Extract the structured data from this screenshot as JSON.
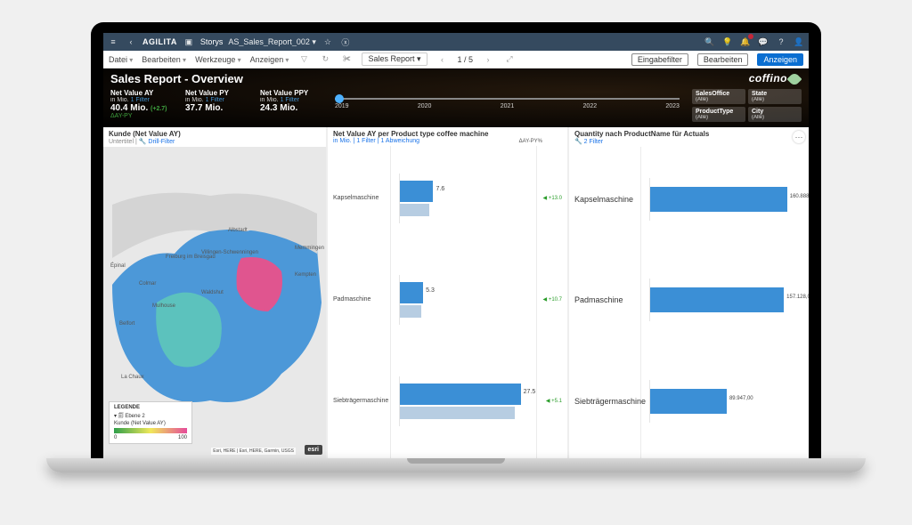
{
  "topbar": {
    "logo": "AGILITA",
    "storys": "Storys",
    "doc_name": "AS_Sales_Report_002 ▾"
  },
  "menubar": {
    "items": [
      "Datei",
      "Bearbeiten",
      "Werkzeuge",
      "Anzeigen"
    ],
    "selector": "Sales Report  ▾",
    "pager": "1 / 5",
    "filter_btn": "Eingabefilter",
    "edit_btn": "Bearbeiten",
    "show_btn": "Anzeigen"
  },
  "header": {
    "title": "Sales Report  - Overview",
    "brand": "coffino",
    "kpis": [
      {
        "label": "Net Value AY",
        "unit": "in Mio.",
        "filter": "1 Filter",
        "value": "40.4 Mio.",
        "delta": "(+2.7)",
        "sub": "ΔAY-PY"
      },
      {
        "label": "Net Value PY",
        "unit": "in Mio.",
        "filter": "1 Filter",
        "value": "37.7 Mio."
      },
      {
        "label": "Net Value PPY",
        "unit": "in Mio.",
        "filter": "1 Filter",
        "value": "24.3 Mio."
      }
    ],
    "timeline_years": [
      "2019",
      "2020",
      "2021",
      "2022",
      "2023"
    ],
    "chips": [
      {
        "label": "SalesOffice",
        "value": "(Alle)"
      },
      {
        "label": "State",
        "value": "(Alle)"
      },
      {
        "label": "ProductType",
        "value": "(Alle)"
      },
      {
        "label": "City",
        "value": "(Alle)"
      }
    ]
  },
  "panel_map": {
    "title": "Kunde (Net Value AY)",
    "subtitle_prefix": "Untertitel |",
    "drill_link": "Drill-Filter",
    "cities": [
      "Épinal",
      "Colmar",
      "Freiburg im Breisgau",
      "Mulhouse",
      "Belfort",
      "La Chaux",
      "Albstadt",
      "Villingen-Schwenningen",
      "Waldshut",
      "Memmingen",
      "Kempten"
    ],
    "legend_title": "LEGENDE",
    "legend_layer": "Ebene 2",
    "legend_metric": "Kunde (Net Value AY)",
    "legend_min": "0",
    "legend_max": "100",
    "credits": "Esri, HERE | Esri, HERE, Garmin, USGS",
    "esri": "esri"
  },
  "panel_mid": {
    "title": "Net Value AY per Product type coffee machine",
    "subtitle": "in Mio. | 1 Filter | 1 Abweichung",
    "delta_head": "ΔAY-PY%"
  },
  "panel_right": {
    "title": "Quantity nach ProductName für Actuals",
    "subtitle": "2 Filter"
  },
  "chart_data": [
    {
      "type": "bar",
      "title": "Net Value AY per Product type coffee machine",
      "ylabel": "in Mio.",
      "categories": [
        "Kapselmaschine",
        "Padmaschine",
        "Siebträgermaschine"
      ],
      "series": [
        {
          "name": "AY",
          "values": [
            7.6,
            5.3,
            27.5
          ]
        },
        {
          "name": "PY",
          "values": [
            6.7,
            4.8,
            26.2
          ]
        }
      ],
      "delta_pct": [
        13.0,
        10.7,
        5.1
      ],
      "xlim": [
        0,
        30
      ]
    },
    {
      "type": "bar",
      "title": "Quantity nach ProductName für Actuals",
      "categories": [
        "Kapselmaschine",
        "Padmaschine",
        "Siebträgermaschine"
      ],
      "values": [
        160888.0,
        157128.0,
        89947.0
      ],
      "xlim": [
        0,
        180000
      ]
    }
  ]
}
